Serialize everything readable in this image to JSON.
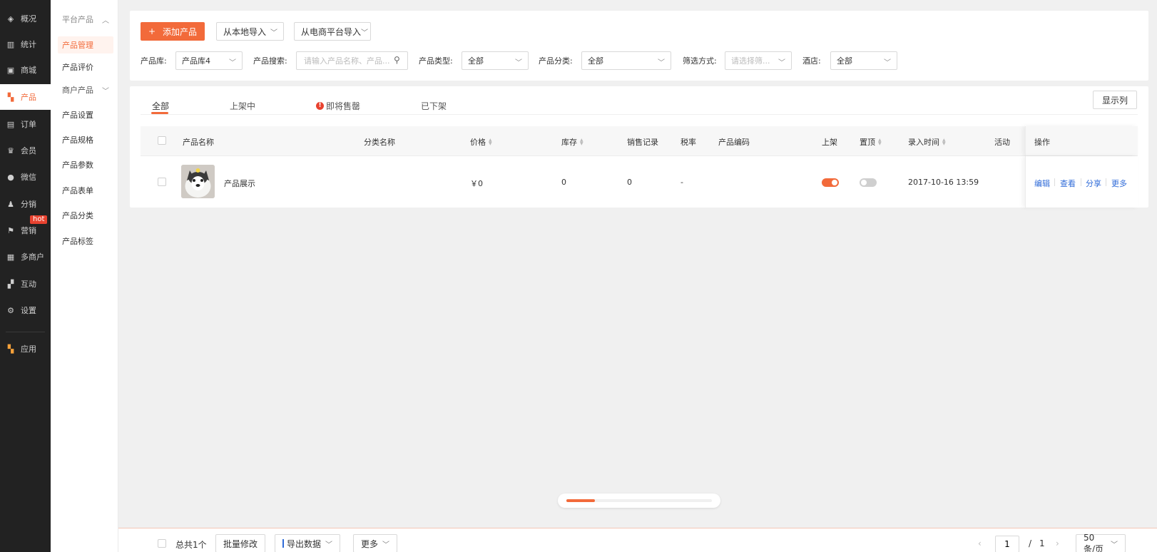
{
  "nav": {
    "items": [
      {
        "label": "概况",
        "icon": "layers-icon"
      },
      {
        "label": "统计",
        "icon": "chart-icon"
      },
      {
        "label": "商城",
        "icon": "store-icon"
      },
      {
        "label": "产品",
        "icon": "grid-icon"
      },
      {
        "label": "订单",
        "icon": "clipboard-icon"
      },
      {
        "label": "会员",
        "icon": "crown-icon"
      },
      {
        "label": "微信",
        "icon": "wechat-icon"
      },
      {
        "label": "分销",
        "icon": "users-icon"
      },
      {
        "label": "营销",
        "icon": "flag-icon"
      },
      {
        "label": "多商户",
        "icon": "building-icon"
      },
      {
        "label": "互动",
        "icon": "apps-icon"
      },
      {
        "label": "设置",
        "icon": "gear-icon"
      },
      {
        "label": "应用",
        "icon": "app-grid-icon"
      }
    ],
    "hot_badge": "hot",
    "active_color": "#f26a3a"
  },
  "subnav": {
    "group1": "平台产品",
    "items": [
      "产品管理",
      "产品评价"
    ],
    "group2": "商户产品",
    "items2": [
      "产品设置",
      "产品规格",
      "产品参数",
      "产品表单",
      "产品分类",
      "产品标签"
    ]
  },
  "toolbar": {
    "add_label": "添加产品",
    "import_local": "从本地导入",
    "import_platform": "从电商平台导入"
  },
  "filters": {
    "library_label": "产品库:",
    "library_value": "产品库4",
    "search_label": "产品搜索:",
    "search_placeholder": "请输入产品名称、产品...",
    "type_label": "产品类型:",
    "type_value": "全部",
    "category_label": "产品分类:",
    "category_value": "全部",
    "filter_label": "筛选方式:",
    "filter_placeholder": "请选择筛...",
    "hotel_label": "酒店:",
    "hotel_value": "全部"
  },
  "tabs": {
    "all": "全部",
    "on_sale": "上架中",
    "selling_out": "即将售罄",
    "off_shelf": "已下架",
    "columns_button": "显示列"
  },
  "table": {
    "headers": {
      "name": "产品名称",
      "category": "分类名称",
      "price": "价格",
      "stock": "库存",
      "sales": "销售记录",
      "tax": "税率",
      "code": "产品编码",
      "shelf": "上架",
      "top": "置顶",
      "time": "录入时间",
      "activity": "活动",
      "actions": "操作"
    },
    "rows": [
      {
        "name": "产品展示",
        "price": "￥0",
        "stock": "0",
        "sales": "0",
        "tax": "-",
        "on_shelf": true,
        "pinned": false,
        "time": "2017-10-16 13:59",
        "actions": [
          "编辑",
          "查看",
          "分享",
          "更多"
        ]
      }
    ]
  },
  "footer": {
    "total": "总共1个",
    "batch_edit": "批量修改",
    "export": "导出数据",
    "more": "更多",
    "page_current": "1",
    "page_sep": "/",
    "page_total": "1",
    "page_size": "50 条/页"
  }
}
